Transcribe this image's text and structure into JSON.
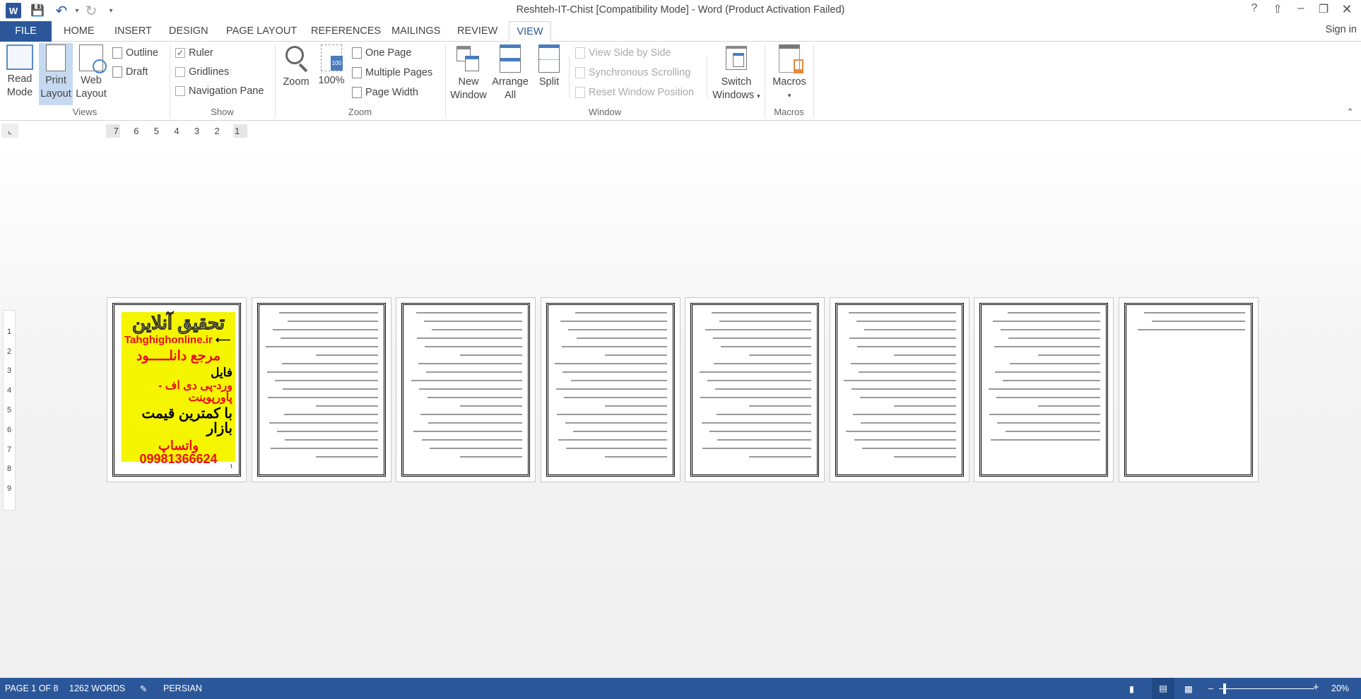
{
  "titlebar": {
    "title": "Reshteh-IT-Chist [Compatibility Mode] - Word (Product Activation Failed)",
    "icons": [
      "word-logo-icon",
      "save-icon",
      "undo-icon",
      "redo-icon",
      "customize-qat-icon"
    ],
    "help": "?",
    "sign_in": "Sign in"
  },
  "tabs": [
    "FILE",
    "HOME",
    "INSERT",
    "DESIGN",
    "PAGE LAYOUT",
    "REFERENCES",
    "MAILINGS",
    "REVIEW",
    "VIEW"
  ],
  "active_tab": "VIEW",
  "ribbon": {
    "views": {
      "label": "Views",
      "read_mode": [
        "Read",
        "Mode"
      ],
      "print_layout": [
        "Print",
        "Layout"
      ],
      "web_layout": [
        "Web",
        "Layout"
      ],
      "outline": "Outline",
      "draft": "Draft",
      "selected": "Print Layout"
    },
    "show": {
      "label": "Show",
      "ruler": "Ruler",
      "ruler_checked": true,
      "gridlines": "Gridlines",
      "gridlines_checked": false,
      "nav_pane": "Navigation Pane",
      "nav_pane_checked": false
    },
    "zoom": {
      "label": "Zoom",
      "zoom": "Zoom",
      "hundred": "100%",
      "one_page": "One Page",
      "multiple_pages": "Multiple Pages",
      "page_width": "Page Width"
    },
    "window": {
      "label": "Window",
      "new_window": [
        "New",
        "Window"
      ],
      "arrange_all": [
        "Arrange",
        "All"
      ],
      "split": "Split",
      "side_by_side": "View Side by Side",
      "sync_scroll": "Synchronous Scrolling",
      "reset_pos": "Reset Window Position",
      "switch": [
        "Switch",
        "Windows"
      ]
    },
    "macros": {
      "label": "Macros",
      "macros": "Macros"
    }
  },
  "ruler": {
    "h": [
      "7",
      "6",
      "5",
      "4",
      "3",
      "2",
      "1"
    ],
    "v": [
      "1",
      "2",
      "3",
      "4",
      "5",
      "6",
      "7",
      "8",
      "9"
    ]
  },
  "document": {
    "page_count": 8,
    "cover": {
      "line1": "تحقیق آنلاین",
      "site": "Tahghighonline.ir",
      "line3": "مرجع دانلـــــود",
      "line4": "فایل",
      "line5": "ورد-پی دی اف - پاورپوینت",
      "line6": "با کمترین قیمت بازار",
      "phone": "09981366624",
      "whatsapp": "واتساپ",
      "page_num": "۱"
    }
  },
  "status": {
    "page": "PAGE 1 OF 8",
    "words": "1262 WORDS",
    "language": "PERSIAN",
    "zoom": "20%",
    "zoom_percent": 20
  },
  "colors": {
    "accent": "#2b579a",
    "ad_bg": "#f5f500",
    "ad_red": "#e8101c"
  }
}
